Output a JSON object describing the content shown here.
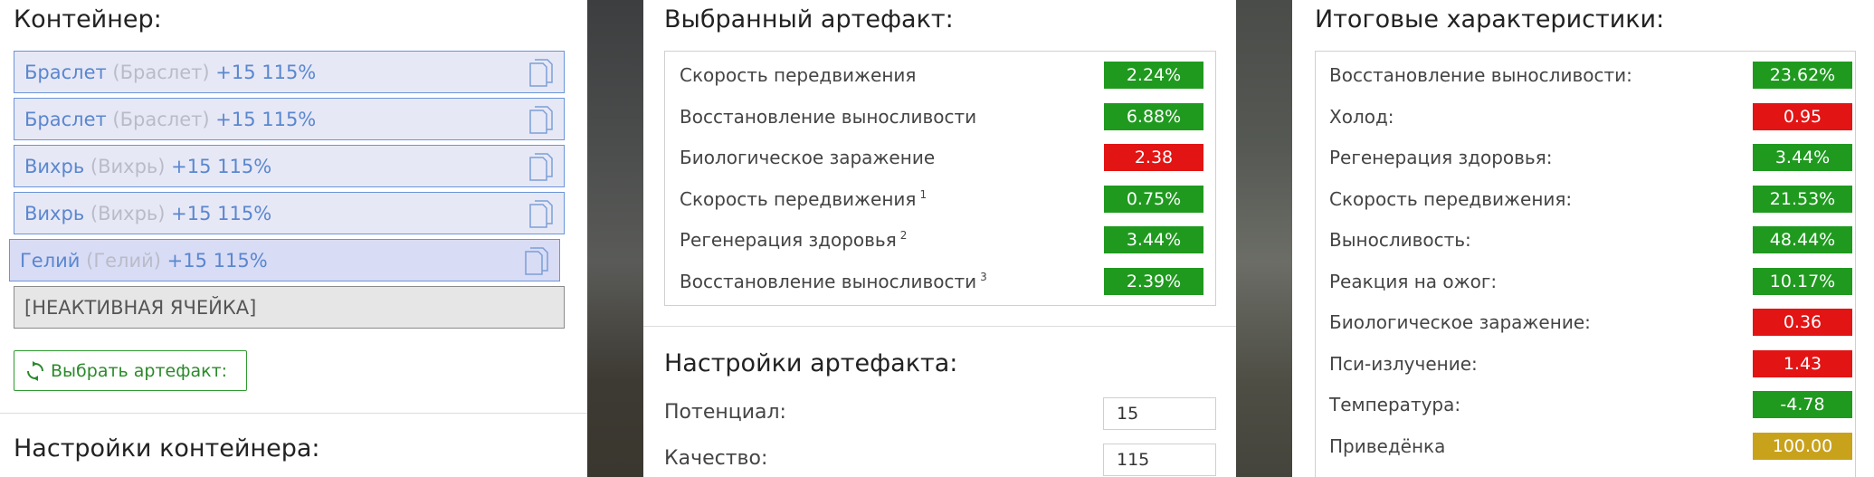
{
  "container": {
    "title": "Контейнер:",
    "slots": [
      {
        "name": "Браслет",
        "alt": "(Браслет)",
        "suffix": "+15 115%"
      },
      {
        "name": "Браслет",
        "alt": "(Браслет)",
        "suffix": "+15 115%"
      },
      {
        "name": "Вихрь",
        "alt": "(Вихрь)",
        "suffix": "+15 115%"
      },
      {
        "name": "Вихрь",
        "alt": "(Вихрь)",
        "suffix": "+15 115%"
      },
      {
        "name": "Гелий",
        "alt": "(Гелий)",
        "suffix": "+15 115%"
      }
    ],
    "inactive_label": "[НЕАКТИВНАЯ ЯЧЕЙКА]",
    "pick_button": "Выбрать артефакт:",
    "settings_title": "Настройки контейнера:"
  },
  "artifact": {
    "title": "Выбранный артефакт:",
    "stats": [
      {
        "label": "Скорость передвижения",
        "note": "",
        "value": "2.24%",
        "status": "positive"
      },
      {
        "label": "Восстановление выносливости",
        "note": "",
        "value": "6.88%",
        "status": "positive"
      },
      {
        "label": "Биологическое заражение",
        "note": "",
        "value": "2.38",
        "status": "negative"
      },
      {
        "label": "Скорость передвижения",
        "note": "1",
        "value": "0.75%",
        "status": "positive"
      },
      {
        "label": "Регенерация здоровья",
        "note": "2",
        "value": "3.44%",
        "status": "positive"
      },
      {
        "label": "Восстановление выносливости",
        "note": "3",
        "value": "2.39%",
        "status": "positive"
      }
    ],
    "settings_title": "Настройки артефакта:",
    "potential_label": "Потенциал:",
    "potential_value": "15",
    "quality_label": "Качество:",
    "quality_value": "115"
  },
  "totals": {
    "title": "Итоговые характеристики:",
    "stats": [
      {
        "label": "Восстановление выносливости:",
        "value": "23.62%",
        "status": "positive"
      },
      {
        "label": "Холод:",
        "value": "0.95",
        "status": "negative"
      },
      {
        "label": "Регенерация здоровья:",
        "value": "3.44%",
        "status": "positive"
      },
      {
        "label": "Скорость передвижения:",
        "value": "21.53%",
        "status": "positive"
      },
      {
        "label": "Выносливость:",
        "value": "48.44%",
        "status": "positive"
      },
      {
        "label": "Реакция на ожог:",
        "value": "10.17%",
        "status": "positive"
      },
      {
        "label": "Биологическое заражение:",
        "value": "0.36",
        "status": "negative"
      },
      {
        "label": "Пси-излучение:",
        "value": "1.43",
        "status": "negative"
      },
      {
        "label": "Температура:",
        "value": "-4.78",
        "status": "positive"
      },
      {
        "label": "Приведёнка",
        "value": "100.00",
        "status": "neutral"
      }
    ]
  },
  "colors": {
    "positive": "#1f9a1f",
    "negative": "#e31414",
    "neutral": "#c9a21c",
    "accent": "#5a87cf"
  },
  "icons": {
    "slot_action": "copy-icon",
    "pick_button": "refresh-icon"
  }
}
